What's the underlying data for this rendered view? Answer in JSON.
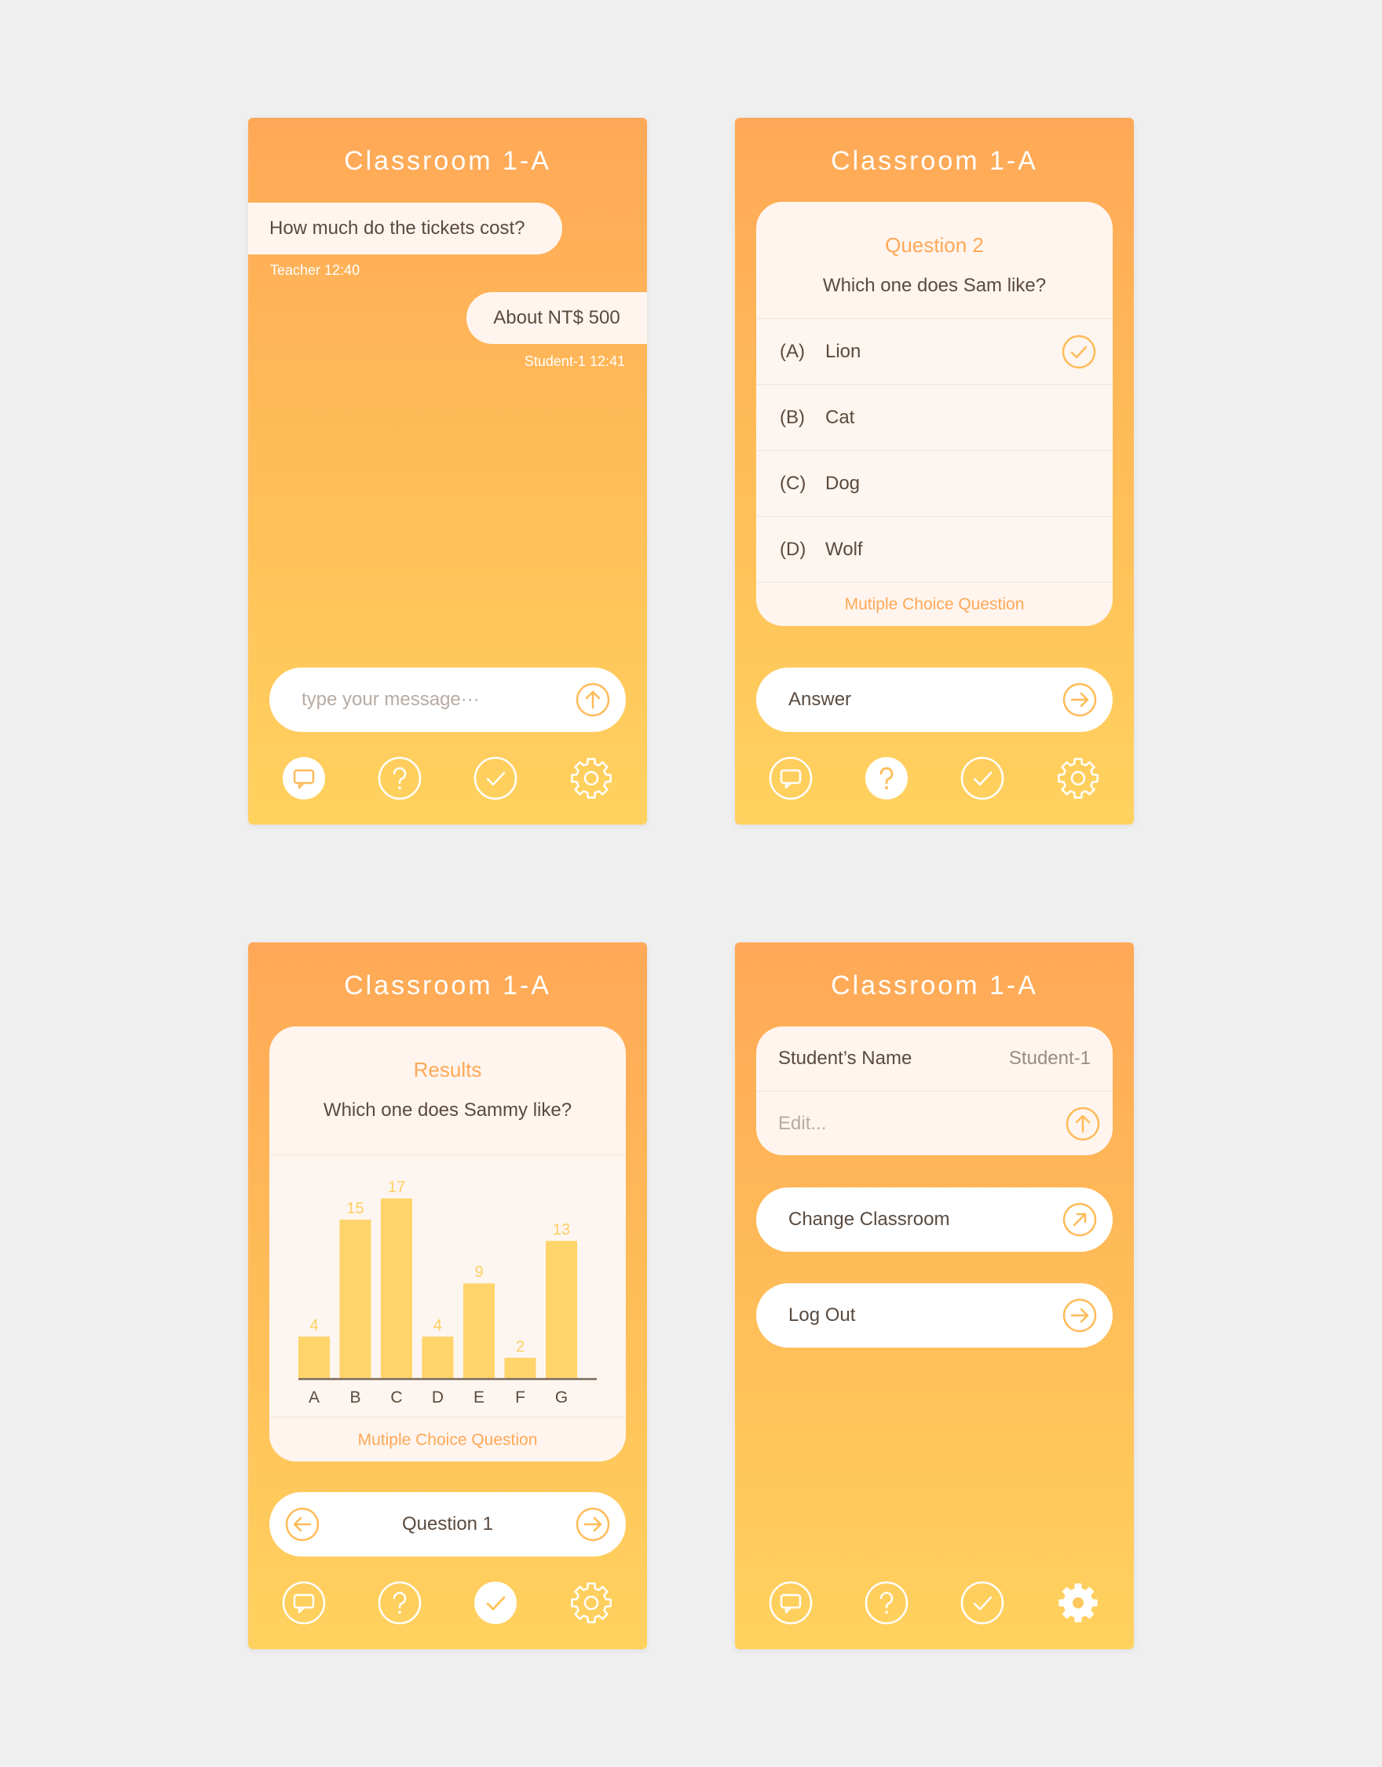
{
  "screens": {
    "chat": {
      "title": "Classroom 1-A",
      "messages": [
        {
          "text": "How much do the tickets cost?",
          "sender": "Teacher",
          "time": "12:40"
        },
        {
          "text": "About NT$ 500",
          "sender": "Student-1",
          "time": "12:41"
        }
      ],
      "meta0": "Teacher  12:40",
      "meta1": "Student-1  12:41",
      "input_placeholder": "type your message···"
    },
    "question": {
      "title": "Classroom 1-A",
      "heading": "Question 2",
      "text": "Which one does Sam like?",
      "options": [
        {
          "letter": "(A)",
          "label": "Lion",
          "selected": true
        },
        {
          "letter": "(B)",
          "label": "Cat",
          "selected": false
        },
        {
          "letter": "(C)",
          "label": "Dog",
          "selected": false
        },
        {
          "letter": "(D)",
          "label": "Wolf",
          "selected": false
        }
      ],
      "footer": "Mutiple Choice Question",
      "answer_label": "Answer"
    },
    "results": {
      "title": "Classroom 1-A",
      "heading": "Results",
      "text": "Which one does Sammy like?",
      "footer": "Mutiple Choice Question",
      "pager_label": "Question 1"
    },
    "settings": {
      "title": "Classroom 1-A",
      "name_label": "Student’s Name",
      "name_value": "Student-1",
      "edit_placeholder": "Edit...",
      "change_classroom": "Change Classroom",
      "log_out": "Log Out"
    }
  },
  "chart_data": {
    "type": "bar",
    "categories": [
      "A",
      "B",
      "C",
      "D",
      "E",
      "F",
      "G"
    ],
    "values": [
      4,
      15,
      17,
      4,
      9,
      2,
      13
    ],
    "ylim": [
      0,
      17
    ],
    "grid": false
  },
  "colors": {
    "gradient_top": "#ffa857",
    "gradient_bottom": "#ffd25f",
    "accent": "#ffa857",
    "bar": "#ffd46a",
    "card": "#fff5ee",
    "text": "#5a4a3e"
  },
  "nav_icons": [
    "chat-bubble-icon",
    "question-icon",
    "check-icon",
    "gear-icon"
  ],
  "active_nav": {
    "chat": 0,
    "question": 1,
    "results": 2,
    "settings": 3
  }
}
